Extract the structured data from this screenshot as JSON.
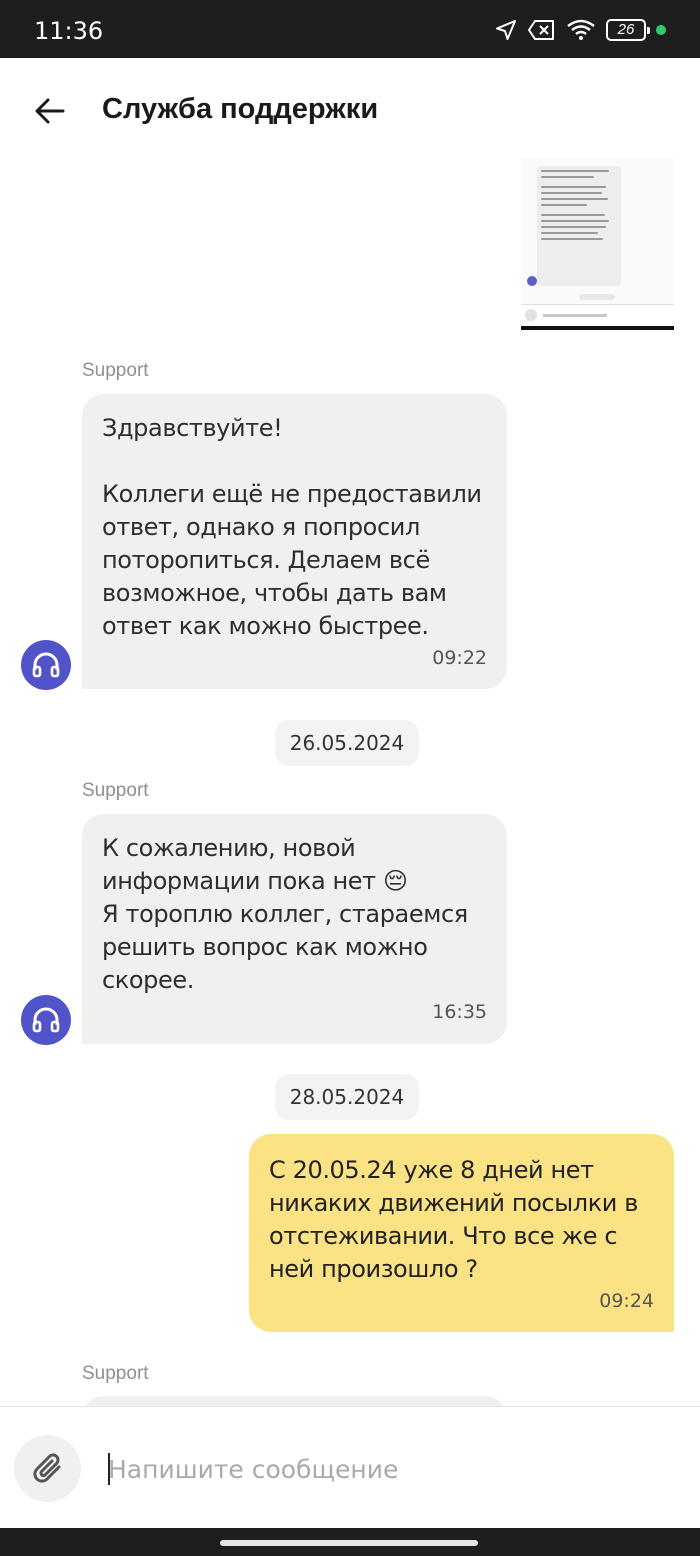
{
  "status_bar": {
    "time": "11:36",
    "battery": "26",
    "icons": [
      "location-arrow-icon",
      "sim-off-icon",
      "wifi-icon",
      "battery-icon",
      "camera-active-dot"
    ],
    "active_dot_color": "#2ecc71"
  },
  "header": {
    "title": "Служба поддержки",
    "back_icon": "arrow-left-icon"
  },
  "messages": [
    {
      "type": "incoming",
      "sender": "Support",
      "text": "Здравствуйте!\n\nКоллеги ещё не предоставили ответ, однако я попросил поторопиться. Делаем всё возможное, чтобы дать вам ответ как можно быстрее.",
      "time": "09:22"
    },
    {
      "type": "date",
      "text": "26.05.2024"
    },
    {
      "type": "incoming",
      "sender": "Support",
      "text": "К сожалению, новой информации пока нет 😔\nЯ тороплю коллег, стараемся решить вопрос как можно скорее.",
      "time": "16:35"
    },
    {
      "type": "date",
      "text": "28.05.2024"
    },
    {
      "type": "outgoing",
      "text": "С 20.05.24 уже 8 дней нет никаких движений посылки в отстеживании. Что все же с ней произошло ?",
      "time": "09:24"
    },
    {
      "type": "incoming-partial",
      "sender": "Support"
    }
  ],
  "composer": {
    "placeholder": "Напишите сообщение",
    "value": "",
    "attach_icon": "paperclip-icon"
  },
  "colors": {
    "incoming_bubble": "#f1f0ee",
    "outgoing_bubble": "#fbe385",
    "avatar": "#5154c8"
  }
}
